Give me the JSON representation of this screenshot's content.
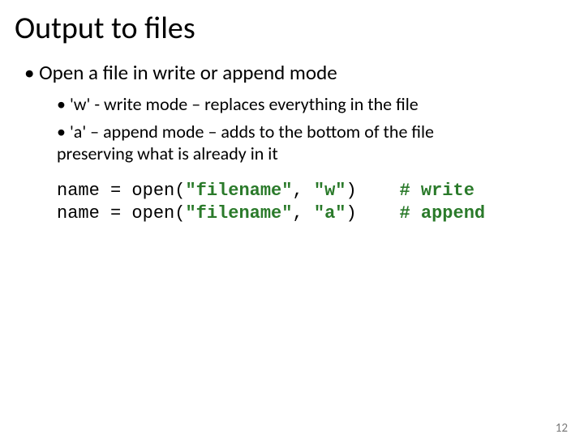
{
  "title": "Output to files",
  "bullets": {
    "l1": "Open a file in write or append mode",
    "l2a": "'w' - write mode – replaces everything in the file",
    "l2b": "'a' – append mode – adds to the bottom of the file preserving what is already in it"
  },
  "code": {
    "line1": {
      "name": "name",
      "eq": " = ",
      "call_a": "open(",
      "str1": "\"filename\"",
      "comma": ", ",
      "str2": "\"w\"",
      "call_b": ")",
      "pad": "    ",
      "comment": "# write"
    },
    "line2": {
      "name": "name",
      "eq": " = ",
      "call_a": "open(",
      "str1": "\"filename\"",
      "comma": ", ",
      "str2": "\"a\"",
      "call_b": ")",
      "pad": "    ",
      "comment": "# append"
    }
  },
  "page_number": "12"
}
